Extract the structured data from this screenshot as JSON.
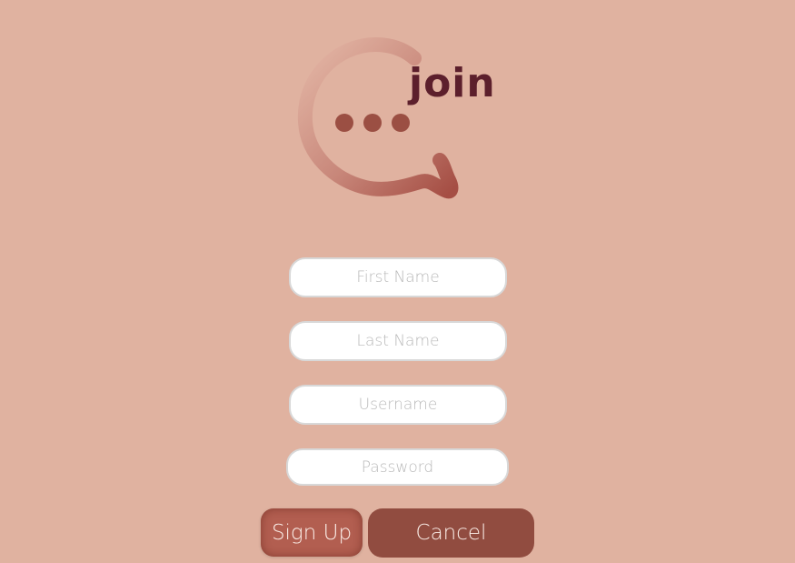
{
  "brand": {
    "logo_text": "join",
    "logo_icon": "chat-bubble-ellipsis-icon"
  },
  "form": {
    "first_name_placeholder": "First Name",
    "last_name_placeholder": "Last Name",
    "username_placeholder": "Username",
    "password_placeholder": "Password"
  },
  "actions": {
    "signup_label": "Sign Up",
    "cancel_label": "Cancel"
  },
  "colors": {
    "background": "#e0b2a0",
    "brand_text": "#5c1f2c",
    "signup_button": "#b25e50",
    "cancel_button": "#914c40",
    "logo_dots": "#9b4f43"
  }
}
